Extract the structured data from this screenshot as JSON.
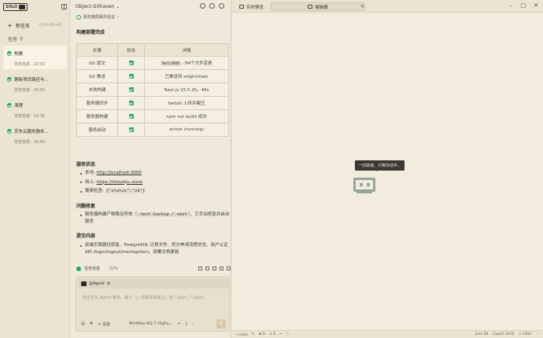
{
  "sidebar": {
    "logo": "SOLO",
    "new_task": "新任务",
    "new_task_shortcut": "Ctrl+Alt+N",
    "tasks_heading": "任务",
    "tasks": [
      {
        "title": "构建",
        "status": "任务完成 · 22:02",
        "active": true
      },
      {
        "title": "更新项目路径与...",
        "status": "任务完成 · 20:55",
        "active": false
      },
      {
        "title": "清理",
        "status": "任务完成 · 11:35",
        "active": false
      },
      {
        "title": "京东云服务器本...",
        "status": "任务完成 · 10:50",
        "active": false
      }
    ]
  },
  "chat": {
    "project": "Object-GXhaven",
    "crumb": "服务器部署并验证",
    "build_title": "构建部署完成",
    "table": {
      "headers": [
        "步骤",
        "状态",
        "详情"
      ],
      "rows": [
        {
          "step": "Git 提交",
          "detail_code": "9e12886",
          "detail": " - 84个文件变更"
        },
        {
          "step": "Git 推送",
          "detail_code": "",
          "detail": "已推送到 origin/main"
        },
        {
          "step": "本地构建",
          "detail_code": "",
          "detail": "Next.js 15.5.20，46s"
        },
        {
          "step": "服务器同步",
          "detail_code": "",
          "detail": "tarball 上传并解压"
        },
        {
          "step": "服务器构建",
          "detail_code": "",
          "detail": "npm run build 成功"
        },
        {
          "step": "服务启动",
          "detail_code": "",
          "detail": "active (running)"
        }
      ]
    },
    "service_title": "服务状态",
    "service": {
      "local_label": "本地: ",
      "local_url": "http://localhost:3000",
      "online_label": "线上: ",
      "online_url": "https://icloudyu.store",
      "health_label": "健康检查: ",
      "health_value": "{\"status\":\"ok\"}"
    },
    "fix_title": "问题修复",
    "fix_pre": "服务器构建产物路径异常（",
    "fix_code": ".next.backup./.next",
    "fix_post": "），已手动修复并启动服务",
    "content_title": "提交内容",
    "content_item": "前端页面路径修复、PostgreSQL 迁移文件、积分申请流程优化、用户认证 API (login/logout/me/register)、部署文档更新",
    "task_complete": "任务完成",
    "progress": "22%",
    "agent": "@Agent",
    "input_placeholder": "您正在与 Agent 聊天。输入「/」获取更多能力，如「/plan」「/spec」",
    "thinking": "深度",
    "model": "MiniMax-M2.7-Highs..."
  },
  "editor": {
    "tab_browser": "实时预览",
    "tab_editor": "编辑器",
    "tooltip": "一切就绪，只等你动手。",
    "status_branch": "main",
    "status_errors": "0",
    "status_warnings": "0",
    "status_line": "Line 50",
    "status_count": "Count 1476",
    "status_eol": "CRLF"
  }
}
